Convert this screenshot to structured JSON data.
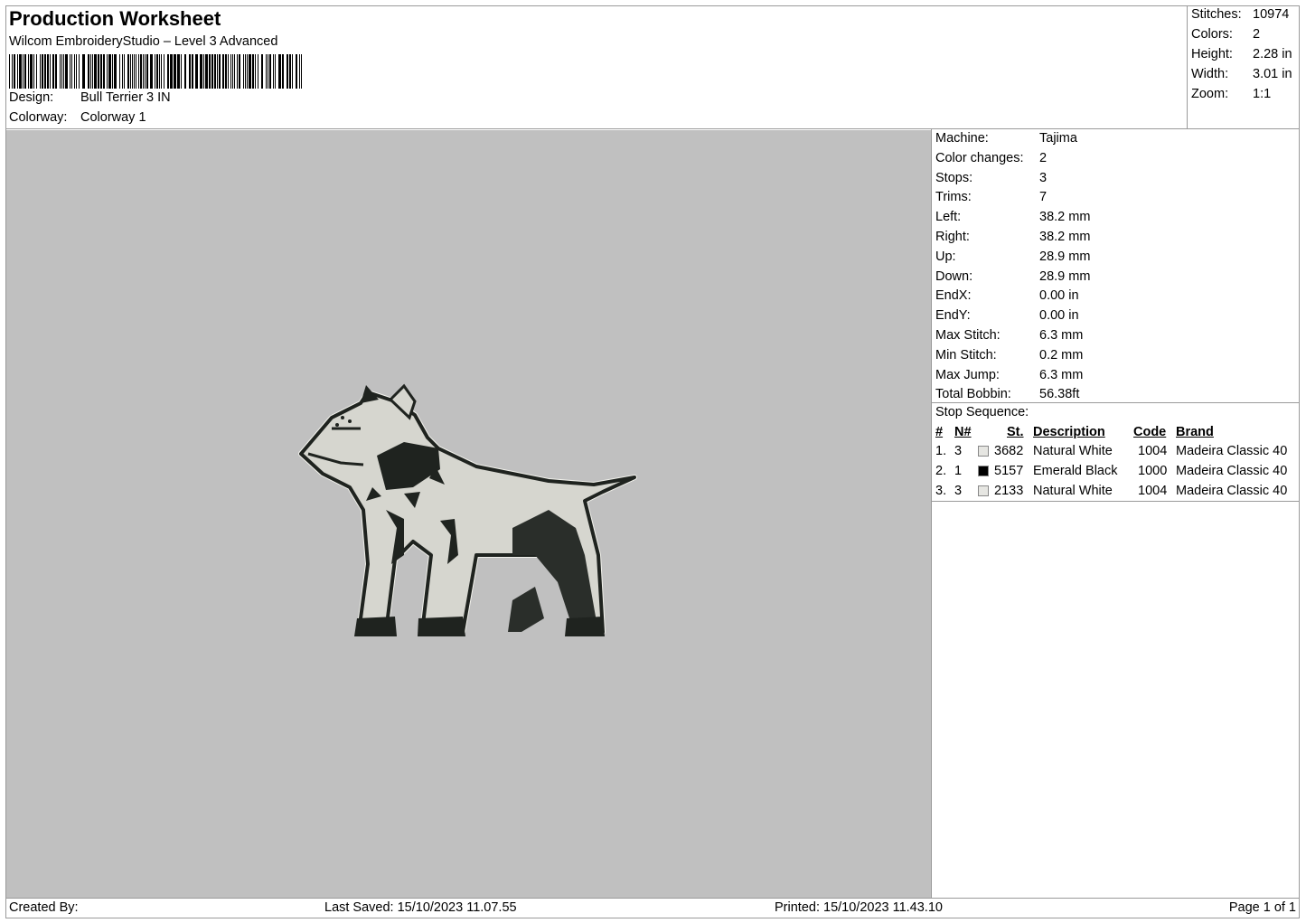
{
  "header": {
    "title": "Production Worksheet",
    "subtitle": "Wilcom EmbroideryStudio – Level 3 Advanced",
    "design_label": "Design:",
    "design_value": "Bull Terrier 3 IN",
    "colorway_label": "Colorway:",
    "colorway_value": "Colorway 1"
  },
  "summary": {
    "stitches_label": "Stitches:",
    "stitches": "10974",
    "colors_label": "Colors:",
    "colors": "2",
    "height_label": "Height:",
    "height": "2.28 in",
    "width_label": "Width:",
    "width": "3.01 in",
    "zoom_label": "Zoom:",
    "zoom": "1:1"
  },
  "machine_info": [
    {
      "label": "Machine:",
      "value": "Tajima"
    },
    {
      "label": "Color changes:",
      "value": "2"
    },
    {
      "label": "Stops:",
      "value": "3"
    },
    {
      "label": "Trims:",
      "value": "7"
    },
    {
      "label": "Left:",
      "value": "38.2 mm"
    },
    {
      "label": "Right:",
      "value": "38.2 mm"
    },
    {
      "label": "Up:",
      "value": "28.9 mm"
    },
    {
      "label": "Down:",
      "value": "28.9 mm"
    },
    {
      "label": "EndX:",
      "value": "0.00 in"
    },
    {
      "label": "EndY:",
      "value": "0.00 in"
    },
    {
      "label": "Max Stitch:",
      "value": "6.3 mm"
    },
    {
      "label": "Min Stitch:",
      "value": "0.2 mm"
    },
    {
      "label": "Max Jump:",
      "value": "6.3 mm"
    },
    {
      "label": "Total Bobbin:",
      "value": "56.38ft"
    }
  ],
  "stop_sequence": {
    "title": "Stop Sequence:",
    "headers": {
      "num": "#",
      "n": "N#",
      "st": "St.",
      "description": "Description",
      "code": "Code",
      "brand": "Brand"
    },
    "rows": [
      {
        "num": "1.",
        "n": "3",
        "color": "#e6e6e2",
        "st": "3682",
        "description": "Natural White",
        "code": "1004",
        "brand": "Madeira Classic 40"
      },
      {
        "num": "2.",
        "n": "1",
        "color": "#000000",
        "st": "5157",
        "description": "Emerald Black",
        "code": "1000",
        "brand": "Madeira Classic 40"
      },
      {
        "num": "3.",
        "n": "3",
        "color": "#e6e6e2",
        "st": "2133",
        "description": "Natural White",
        "code": "1004",
        "brand": "Madeira Classic 40"
      }
    ]
  },
  "footer": {
    "created_by": "Created By:",
    "last_saved": "Last Saved: 15/10/2023 11.07.55",
    "printed": "Printed: 15/10/2023 11.43.10",
    "page": "Page 1 of 1"
  },
  "canvas": {
    "background": "#c0c0c0",
    "design_image": "bull-terrier-embroidery"
  }
}
